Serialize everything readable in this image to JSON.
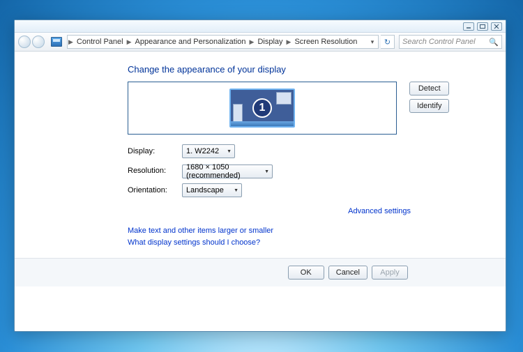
{
  "breadcrumb": {
    "items": [
      "Control Panel",
      "Appearance and Personalization",
      "Display",
      "Screen Resolution"
    ]
  },
  "search": {
    "placeholder": "Search Control Panel"
  },
  "heading": "Change the appearance of your display",
  "monitor_number": "1",
  "buttons": {
    "detect": "Detect",
    "identify": "Identify",
    "ok": "OK",
    "cancel": "Cancel",
    "apply": "Apply"
  },
  "labels": {
    "display": "Display:",
    "resolution": "Resolution:",
    "orientation": "Orientation:"
  },
  "values": {
    "display": "1. W2242",
    "resolution": "1680 × 1050 (recommended)",
    "orientation": "Landscape"
  },
  "links": {
    "advanced": "Advanced settings",
    "larger": "Make text and other items larger or smaller",
    "help": "What display settings should I choose?"
  }
}
